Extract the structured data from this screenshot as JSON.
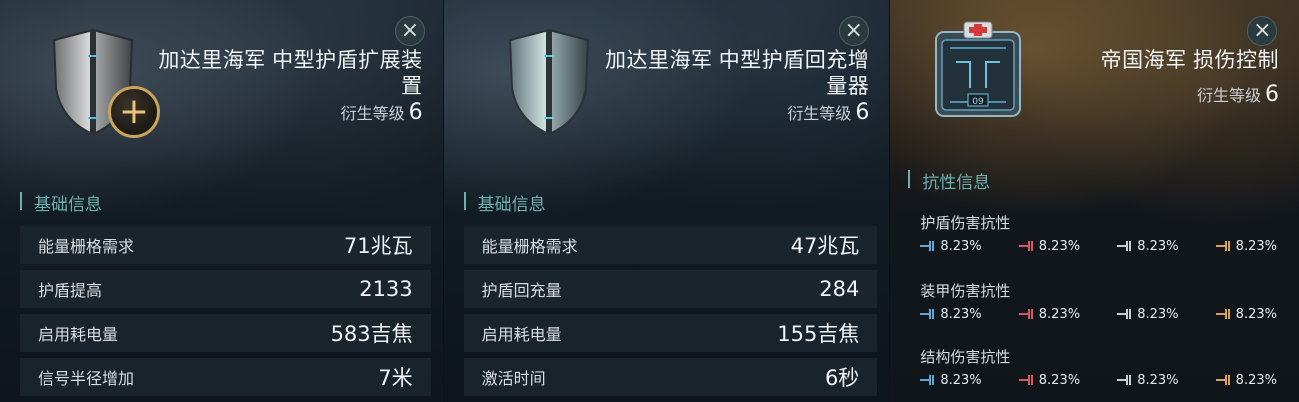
{
  "panels": [
    {
      "title": "加达里海军 中型护盾扩展装置",
      "tech_label": "衍生等级",
      "tech_value": "6",
      "section": "基础信息",
      "rows": [
        {
          "label": "能量栅格需求",
          "value": "71兆瓦"
        },
        {
          "label": "护盾提高",
          "value": "2133"
        },
        {
          "label": "启用耗电量",
          "value": "583吉焦"
        },
        {
          "label": "信号半径增加",
          "value": "7米"
        }
      ]
    },
    {
      "title": "加达里海军 中型护盾回充增量器",
      "tech_label": "衍生等级",
      "tech_value": "6",
      "section": "基础信息",
      "rows": [
        {
          "label": "能量栅格需求",
          "value": "47兆瓦"
        },
        {
          "label": "护盾回充量",
          "value": "284"
        },
        {
          "label": "启用耗电量",
          "value": "155吉焦"
        },
        {
          "label": "激活时间",
          "value": "6秒"
        }
      ]
    },
    {
      "title": "帝国海军 损伤控制",
      "tech_label": "衍生等级",
      "tech_value": "6",
      "section": "抗性信息",
      "box_label": "09",
      "resists": [
        {
          "label": "护盾伤害抗性",
          "values": [
            "8.23%",
            "8.23%",
            "8.23%",
            "8.23%"
          ]
        },
        {
          "label": "装甲伤害抗性",
          "values": [
            "8.23%",
            "8.23%",
            "8.23%",
            "8.23%"
          ]
        },
        {
          "label": "结构伤害抗性",
          "values": [
            "8.23%",
            "8.23%",
            "8.23%",
            "8.23%"
          ]
        }
      ]
    }
  ],
  "damage_types": [
    {
      "name": "em",
      "color": "#5fa8d8"
    },
    {
      "name": "thermal",
      "color": "#d8575a"
    },
    {
      "name": "kinetic",
      "color": "#c9cfd3"
    },
    {
      "name": "explosive",
      "color": "#d9a15a"
    }
  ],
  "icons": {
    "close": "close-icon",
    "badge": "plus-icon"
  }
}
